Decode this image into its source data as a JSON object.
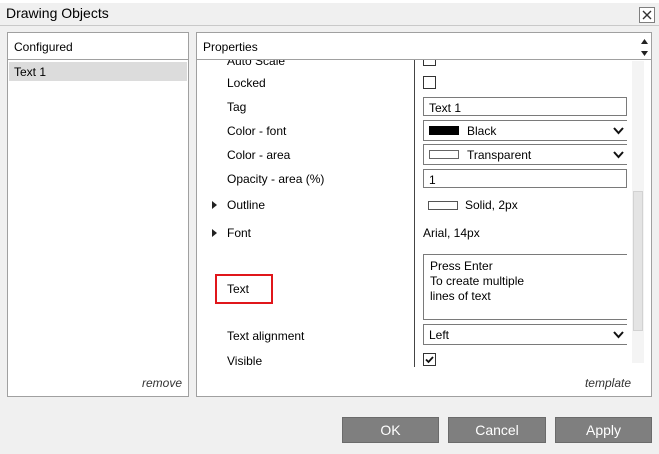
{
  "window": {
    "title": "Drawing Objects"
  },
  "configured": {
    "header": "Configured",
    "items": [
      {
        "label": "Text 1"
      }
    ],
    "remove_label": "remove"
  },
  "properties": {
    "header": "Properties",
    "partial_row_label": "Auto Scale",
    "locked": {
      "label": "Locked",
      "checked": false
    },
    "tag": {
      "label": "Tag",
      "value": "Text 1"
    },
    "color_font": {
      "label": "Color - font",
      "value": "Black",
      "swatch": "#000000"
    },
    "color_area": {
      "label": "Color - area",
      "value": "Transparent",
      "swatch": "#ffffff"
    },
    "opacity_area": {
      "label": "Opacity - area (%)",
      "value": "1"
    },
    "outline": {
      "label": "Outline",
      "value": "Solid, 2px"
    },
    "font": {
      "label": "Font",
      "value": "Arial, 14px"
    },
    "text": {
      "label": "Text",
      "lines": [
        "Press Enter",
        "To create multiple",
        "lines of text"
      ]
    },
    "text_alignment": {
      "label": "Text alignment",
      "value": "Left"
    },
    "visible": {
      "label": "Visible",
      "checked": true
    },
    "template_label": "template"
  },
  "buttons": {
    "ok": "OK",
    "cancel": "Cancel",
    "apply": "Apply"
  },
  "colors": {
    "highlight": "#e0161b",
    "button_bg": "#7f7f7f"
  },
  "icons": [
    "close-icon",
    "scroll-up-icon",
    "scroll-down-icon",
    "expand-arrow-icon",
    "chevron-down-icon",
    "checkmark-icon"
  ]
}
